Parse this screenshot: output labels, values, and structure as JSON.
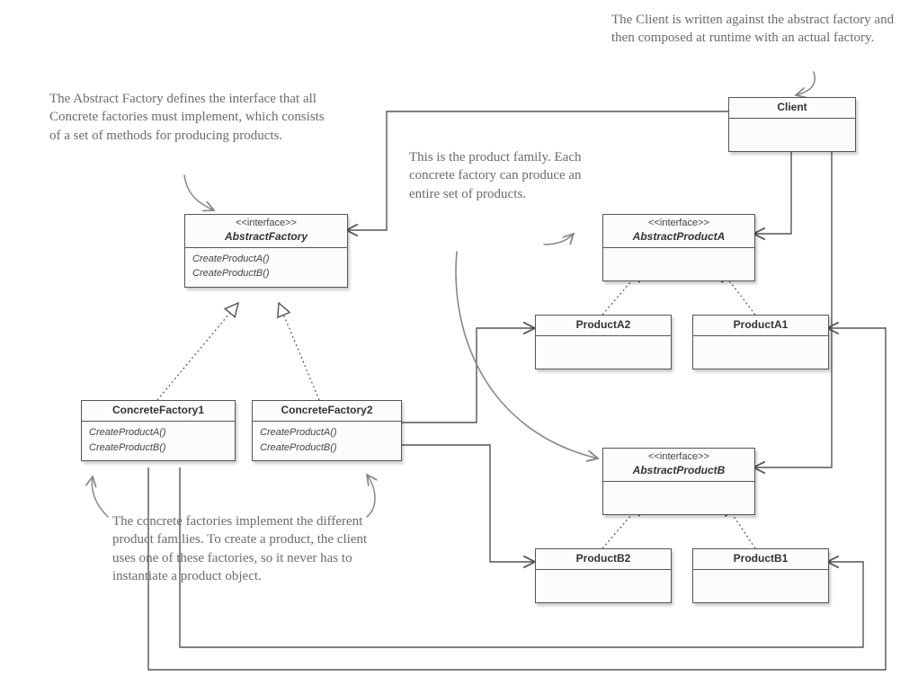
{
  "boxes": {
    "client": {
      "stereo": "",
      "name": "Client",
      "ops": []
    },
    "abstractFactory": {
      "stereo": "<<interface>>",
      "name": "AbstractFactory",
      "ops": [
        "CreateProductA()",
        "CreateProductB()"
      ]
    },
    "concreteFactory1": {
      "stereo": "",
      "name": "ConcreteFactory1",
      "ops": [
        "CreateProductA()",
        "CreateProductB()"
      ]
    },
    "concreteFactory2": {
      "stereo": "",
      "name": "ConcreteFactory2",
      "ops": [
        "CreateProductA()",
        "CreateProductB()"
      ]
    },
    "abstractProductA": {
      "stereo": "<<interface>>",
      "name": "AbstractProductA",
      "ops": []
    },
    "productA1": {
      "stereo": "",
      "name": "ProductA1",
      "ops": []
    },
    "productA2": {
      "stereo": "",
      "name": "ProductA2",
      "ops": []
    },
    "abstractProductB": {
      "stereo": "<<interface>>",
      "name": "AbstractProductB",
      "ops": []
    },
    "productB1": {
      "stereo": "",
      "name": "ProductB1",
      "ops": []
    },
    "productB2": {
      "stereo": "",
      "name": "ProductB2",
      "ops": []
    }
  },
  "notes": {
    "client": "The Client is written against the abstract factory and then composed at runtime with an actual factory.",
    "factory": "The Abstract Factory defines the interface that all Concrete factories must implement, which consists of a set of methods for producing products.",
    "family": "This is the product family. Each concrete factory can produce an entire set of products.",
    "concrete": "The concrete factories implement the different product families. To create a product, the client uses one of these factories, so it never has to instantiate a product object."
  }
}
